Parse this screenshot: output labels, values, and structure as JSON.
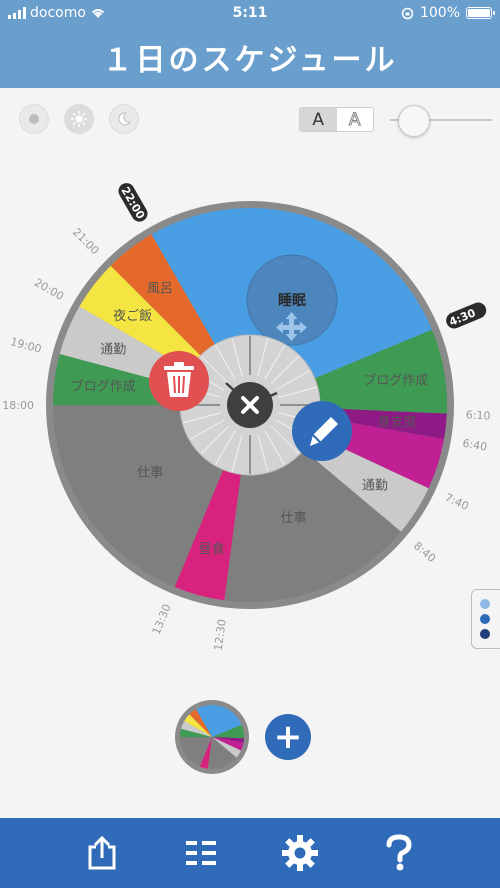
{
  "status": {
    "carrier": "docomo",
    "time": "5:11",
    "battery": "100%"
  },
  "header": {
    "title": "１日のスケジュール"
  },
  "toolbar": {
    "font_sel": "A",
    "font_outline": "A",
    "slider_value": 0.1
  },
  "colors": {
    "header": "#6a9ecd",
    "bottom": "#2f6bb8",
    "sleep": "#4a9ee3",
    "blog": "#3f9a53",
    "magenta": "#c11f94",
    "prep": "#8e1a86",
    "gray": "#7f7f7f",
    "light": "#cacaca",
    "orange": "#e5692a",
    "yellow": "#f4e542",
    "pink": "#d8237e"
  },
  "schedule": {
    "segments": [
      {
        "start": "4:30",
        "end": "6:10",
        "label": "ブログ作成",
        "color": "#3f9a53"
      },
      {
        "start": "6:10",
        "end": "6:40",
        "label": "身支度",
        "color": "#8e1a86"
      },
      {
        "start": "6:40",
        "end": "7:40",
        "label": "",
        "color": "#c11f94"
      },
      {
        "start": "7:40",
        "end": "8:40",
        "label": "通勤",
        "color": "#cacaca"
      },
      {
        "start": "8:40",
        "end": "12:30",
        "label": "仕事",
        "color": "#7f7f7f"
      },
      {
        "start": "12:30",
        "end": "13:30",
        "label": "昼食",
        "color": "#d8237e"
      },
      {
        "start": "13:30",
        "end": "18:00",
        "label": "仕事",
        "color": "#7f7f7f"
      },
      {
        "start": "18:00",
        "end": "19:00",
        "label": "ブログ作成",
        "color": "#3f9a53"
      },
      {
        "start": "19:00",
        "end": "20:00",
        "label": "通勤",
        "color": "#cacaca"
      },
      {
        "start": "20:00",
        "end": "21:00",
        "label": "夜ご飯",
        "color": "#f4e542"
      },
      {
        "start": "21:00",
        "end": "22:00",
        "label": "風呂",
        "color": "#e5692a"
      },
      {
        "start": "22:00",
        "end": "4:30",
        "label": "睡眠",
        "color": "#4a9ee3"
      }
    ],
    "tick_labels": [
      "22:00",
      "21:00",
      "20:00",
      "19:00",
      "18:00",
      "13:30",
      "12:30",
      "8:40",
      "7:40",
      "6:40",
      "6:10",
      "4:30"
    ]
  },
  "icons": {
    "mode1": "sunset-icon",
    "mode2": "sun-icon",
    "mode3": "moon-icon",
    "trash": "trash-icon",
    "close": "close-icon",
    "edit": "pencil-icon",
    "move": "move-icon",
    "add": "plus-icon",
    "tab1": "share-icon",
    "tab2": "list-icon",
    "tab3": "gear-icon",
    "tab4": "help-icon"
  },
  "right_tab_dots": [
    "#8fb8e6",
    "#2f6bb8",
    "#1f3f7a"
  ],
  "add_label": "+"
}
